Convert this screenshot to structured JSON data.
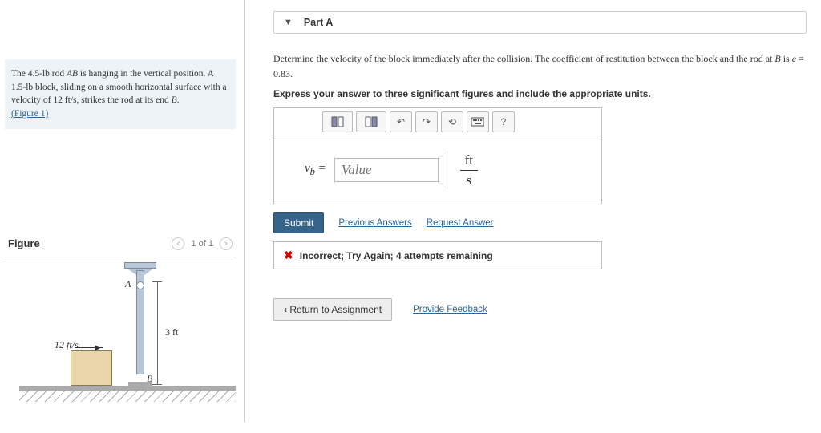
{
  "problem": {
    "text_parts": [
      "The 4.5-lb rod ",
      "AB",
      " is hanging in the vertical position. A 1.5-lb block, sliding on a smooth horizontal surface with a velocity of 12 ft/s, strikes the rod at its end ",
      "B",
      "."
    ],
    "fig_link": "(Figure 1)"
  },
  "figure": {
    "title": "Figure",
    "counter": "1 of 1",
    "labels": {
      "A": "A",
      "B": "B",
      "length": "3 ft",
      "velocity": "12 ft/s"
    }
  },
  "part": {
    "label": "Part A"
  },
  "question": {
    "prefix": "Determine the velocity of the block immediately after the collision. The coefficient of restitution between the block and the rod at ",
    "pointB": "B",
    "mid": " is ",
    "eVar": "e",
    "suffix": " = 0.83.",
    "instructions": "Express your answer to three significant figures and include the appropriate units."
  },
  "toolbar": {
    "icons": [
      "template-1-icon",
      "template-2-icon",
      "undo-icon",
      "redo-icon",
      "reset-icon",
      "keyboard-icon",
      "help-icon"
    ]
  },
  "answer": {
    "var_label": "v_b =",
    "placeholder": "Value",
    "unit_top": "ft",
    "unit_bot": "s"
  },
  "actions": {
    "submit": "Submit",
    "previous": "Previous Answers",
    "request": "Request Answer"
  },
  "feedback": {
    "text": "Incorrect; Try Again; 4 attempts remaining"
  },
  "footer": {
    "return": "Return to Assignment",
    "provide": "Provide Feedback"
  }
}
